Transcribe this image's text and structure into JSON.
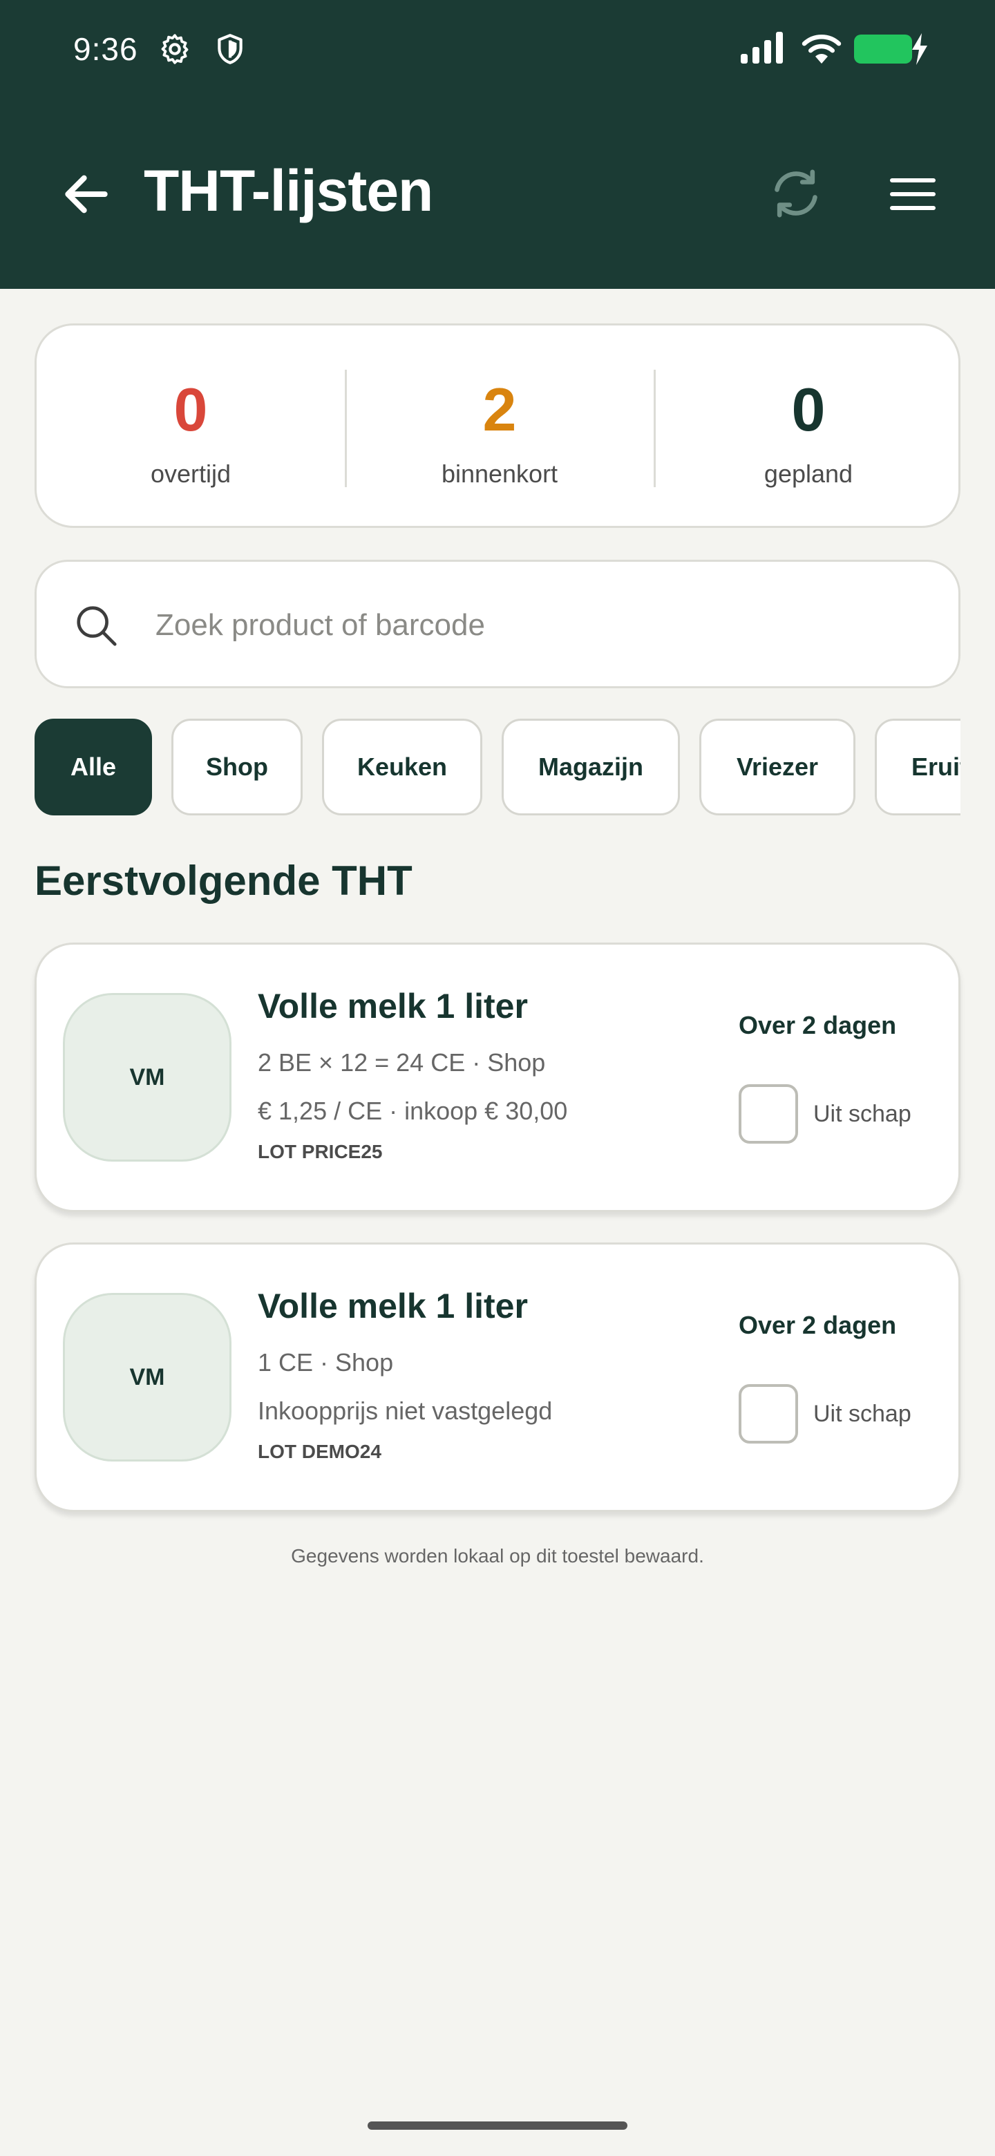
{
  "status_bar": {
    "time": "9:36",
    "icons": [
      "gear-icon",
      "shield-icon",
      "signal-icon",
      "wifi-icon",
      "battery-charging-icon"
    ]
  },
  "header": {
    "title": "THT-lijsten",
    "back_icon": "arrow-left-icon",
    "sync_icon": "sync-icon",
    "menu_icon": "hamburger-menu-icon"
  },
  "summary": {
    "overdue": {
      "value": "0",
      "label": "overtijd",
      "color": "#d9473a"
    },
    "soon": {
      "value": "2",
      "label": "binnenkort",
      "color": "#d9840f"
    },
    "planned": {
      "value": "0",
      "label": "gepland",
      "color": "#17352f"
    }
  },
  "search": {
    "placeholder": "Zoek product of barcode",
    "value": ""
  },
  "filters": {
    "selected": "Alle",
    "chips": [
      "Alle",
      "Shop",
      "Keuken",
      "Magazijn",
      "Vriezer",
      "Eruit"
    ]
  },
  "section": {
    "title": "Eerstvolgende THT"
  },
  "items": [
    {
      "initials": "VM",
      "name": "Volle melk 1 liter",
      "quantity": "2 BE × 12 = 24 CE · Shop",
      "price": "€ 1,25 / CE · inkoop € 30,00",
      "lot": "LOT PRICE25",
      "due": "Over 2 dagen",
      "checkbox_label": "Uit schap",
      "checked": false
    },
    {
      "initials": "VM",
      "name": "Volle melk 1 liter",
      "quantity": "1 CE · Shop",
      "price": "Inkoopprijs niet vastgelegd",
      "lot": "LOT DEMO24",
      "due": "Over 2 dagen",
      "checkbox_label": "Uit schap",
      "checked": false
    }
  ],
  "footer": {
    "note": "Gegevens worden lokaal op dit toestel bewaard."
  },
  "colors": {
    "header_bg": "#1b3b34",
    "page_bg": "#f4f4f0",
    "accent": "#1b3b34",
    "battery": "#22c55e"
  }
}
